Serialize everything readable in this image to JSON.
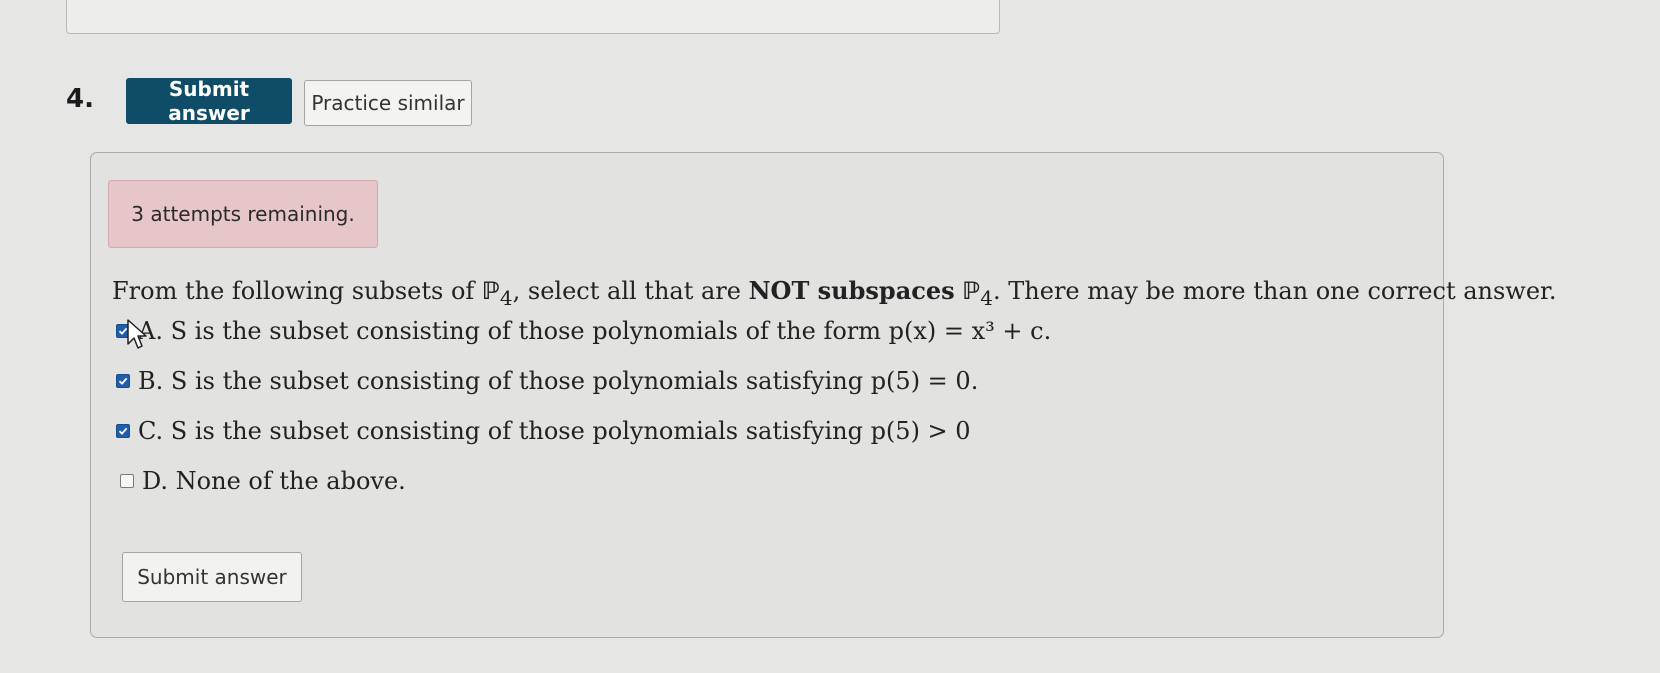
{
  "question": {
    "number": "4.",
    "prompt_part1": "From the following subsets of ",
    "prompt_sym1": "ℙ",
    "prompt_sub1": "4",
    "prompt_part2": ", select all that are ",
    "prompt_bold": "NOT subspaces",
    "prompt_part3": " ",
    "prompt_sym2": "ℙ",
    "prompt_sub2": "4",
    "prompt_part4": ". There may be more than one correct answer."
  },
  "toolbar": {
    "submit_label": "Submit answer",
    "practice_label": "Practice similar"
  },
  "attempts": {
    "text": "3 attempts remaining."
  },
  "choices": [
    {
      "letter": "A.",
      "text": "S is the subset consisting of those polynomials of the form p(x) = x³ + c.",
      "checked": true
    },
    {
      "letter": "B.",
      "text": "S is the subset consisting of those polynomials satisfying p(5) = 0.",
      "checked": true
    },
    {
      "letter": "C.",
      "text": "S is the subset consisting of those polynomials satisfying p(5) > 0",
      "checked": true
    },
    {
      "letter": "D.",
      "text": "None of the above.",
      "checked": false
    }
  ],
  "footer": {
    "submit_label": "Submit answer"
  },
  "icons": {
    "checkbox_checked": "check-icon",
    "pointer": "cursor-arrow-icon"
  },
  "colors": {
    "primary_button": "#0f4c68",
    "attempts_bg": "#e6c6c8",
    "checkbox": "#1e5eaa"
  }
}
